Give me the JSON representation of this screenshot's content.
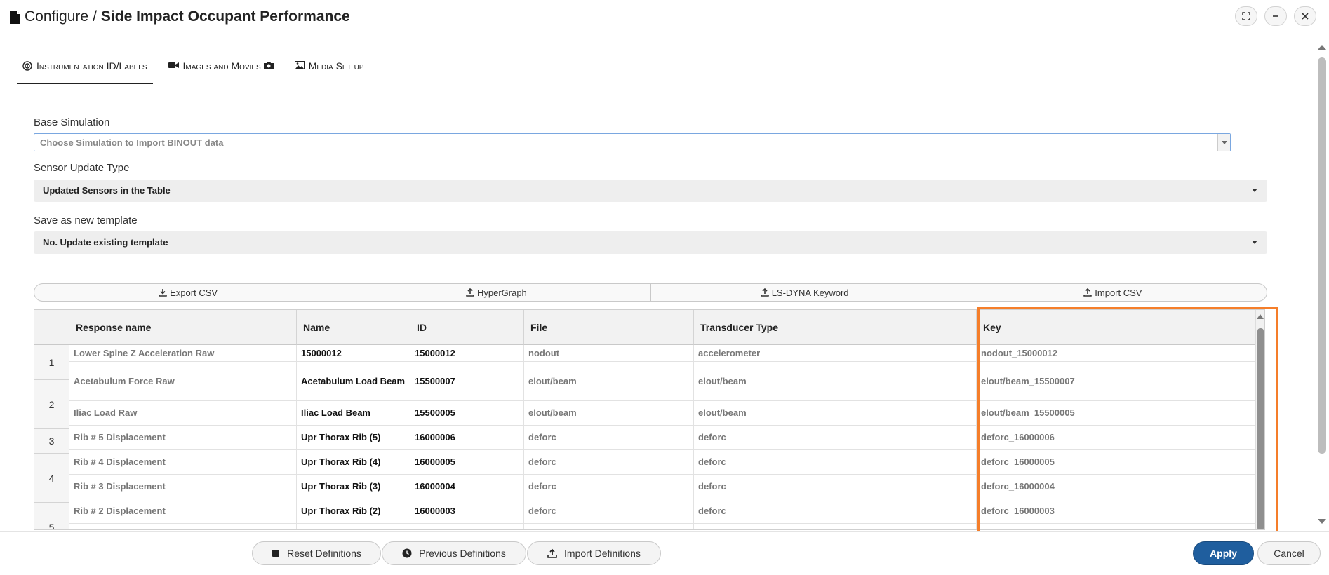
{
  "window": {
    "breadcrumb": "Configure",
    "separator": "/",
    "title": "Side Impact Occupant Performance",
    "buttons": [
      "expand-icon",
      "minimize-icon",
      "close-icon"
    ]
  },
  "tabs": [
    {
      "label": "Instrumentation ID/Labels",
      "icon": "target-icon",
      "active": true
    },
    {
      "label": "Images and Movies",
      "icon": "video-camera-icon",
      "after_icon": "camera-icon",
      "active": false
    },
    {
      "label": "Media Set up",
      "icon": "picture-icon",
      "active": false
    }
  ],
  "base_simulation": {
    "label": "Base Simulation",
    "placeholder": "Choose Simulation to Import BINOUT data"
  },
  "sensor_update": {
    "label": "Sensor Update Type",
    "value": "Updated Sensors in the Table"
  },
  "save_template": {
    "label": "Save as new template",
    "value": "No. Update existing template"
  },
  "actions": [
    {
      "label": "Export CSV",
      "icon": "download-icon"
    },
    {
      "label": "HyperGraph",
      "icon": "upload-icon"
    },
    {
      "label": "LS-DYNA Keyword",
      "icon": "upload-icon"
    },
    {
      "label": "Import CSV",
      "icon": "upload-icon"
    }
  ],
  "table": {
    "columns": [
      "Response name",
      "Name",
      "ID",
      "File",
      "Transducer Type",
      "Key"
    ],
    "row_numbers": [
      "1",
      "2",
      "3",
      "4",
      "5"
    ],
    "rows": [
      {
        "response": "Lower Spine Z Acceleration Raw",
        "name": "15000012",
        "id": "15000012",
        "file": "nodout",
        "transducer": "accelerometer",
        "key": "nodout_15000012"
      },
      {
        "response": "Acetabulum Force Raw",
        "name": "Acetabulum Load Beam",
        "id": "15500007",
        "file": "elout/beam",
        "transducer": "elout/beam",
        "key": "elout/beam_15500007"
      },
      {
        "response": "Iliac Load Raw",
        "name": "Iliac Load Beam",
        "id": "15500005",
        "file": "elout/beam",
        "transducer": "elout/beam",
        "key": "elout/beam_15500005"
      },
      {
        "response": "Rib # 5 Displacement",
        "name": "Upr Thorax Rib (5)",
        "id": "16000006",
        "file": "deforc",
        "transducer": "deforc",
        "key": "deforc_16000006"
      },
      {
        "response": "Rib # 4 Displacement",
        "name": "Upr Thorax Rib (4)",
        "id": "16000005",
        "file": "deforc",
        "transducer": "deforc",
        "key": "deforc_16000005"
      },
      {
        "response": "Rib # 3 Displacement",
        "name": "Upr Thorax Rib (3)",
        "id": "16000004",
        "file": "deforc",
        "transducer": "deforc",
        "key": "deforc_16000004"
      },
      {
        "response": "Rib # 2 Displacement",
        "name": "Upr Thorax Rib (2)",
        "id": "16000003",
        "file": "deforc",
        "transducer": "deforc",
        "key": "deforc_16000003"
      }
    ]
  },
  "footer": {
    "reset": "Reset Definitions",
    "previous": "Previous Definitions",
    "import": "Import Definitions",
    "apply": "Apply",
    "cancel": "Cancel"
  },
  "colors": {
    "highlight": "#f57e2a",
    "primary": "#1f5e9e"
  }
}
